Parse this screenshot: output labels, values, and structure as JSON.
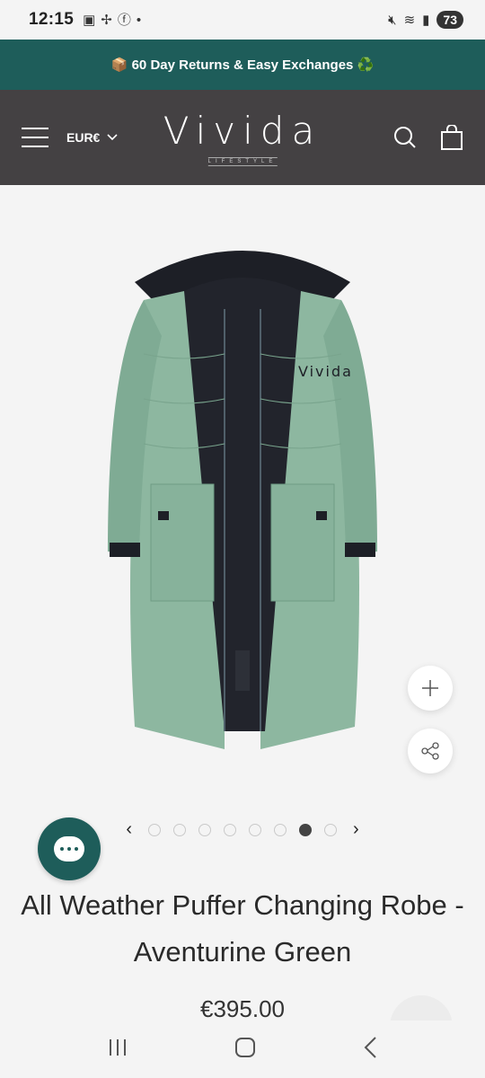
{
  "status_bar": {
    "time": "12:15",
    "left_icons": [
      "screenshot-icon",
      "pinwheel-icon",
      "facebook-icon"
    ],
    "battery": "73"
  },
  "announcement": {
    "text": "📦 60 Day Returns & Easy Exchanges ♻️"
  },
  "header": {
    "currency": "EUR€",
    "logo": "Vivida",
    "logo_sub": "LIFESTYLE"
  },
  "product": {
    "title": "All Weather Puffer Changing Robe - Aventurine Green",
    "price": "€395.00",
    "coat_logo": "Vivida",
    "carousel": {
      "total": 8,
      "active_index": 6
    }
  },
  "colors": {
    "brand": "#1e5d5a",
    "header_bg": "#444143",
    "coat": "#8db7a0"
  }
}
